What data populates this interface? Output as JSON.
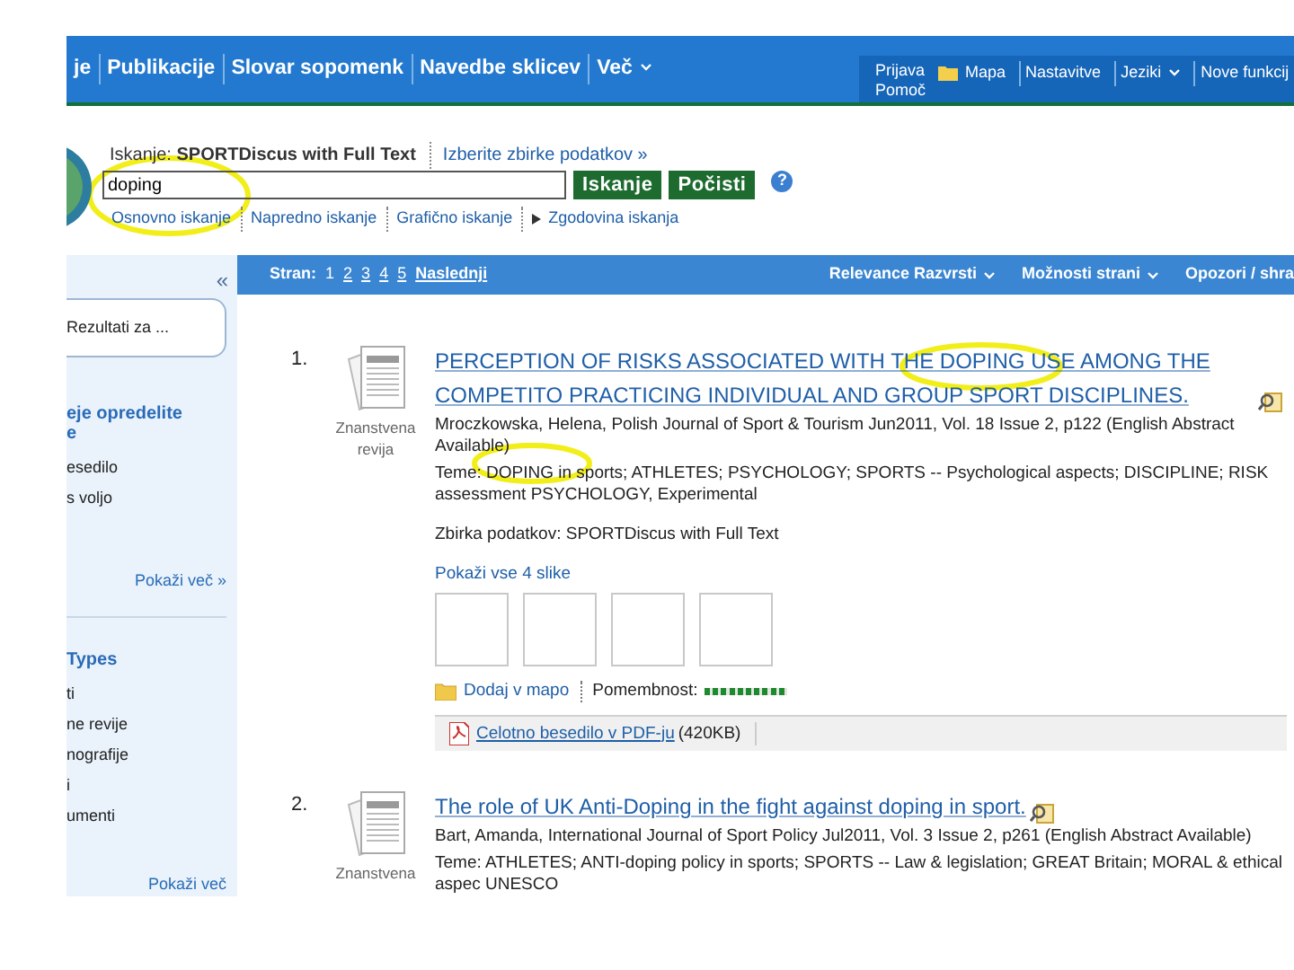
{
  "nav": {
    "items": [
      {
        "label": "je",
        "kind": "link"
      },
      {
        "label": "Publikacije",
        "kind": "link"
      },
      {
        "label": "Slovar sopomenk",
        "kind": "link"
      },
      {
        "label": "Navedbe sklicev",
        "kind": "link"
      },
      {
        "label": "Več",
        "kind": "dropdown"
      }
    ],
    "account": [
      "Prijava",
      "Pomoč"
    ],
    "tools": [
      {
        "label": "Mapa",
        "kind": "folder"
      },
      {
        "label": "Nastavitve",
        "kind": "link"
      },
      {
        "label": "Jeziki",
        "kind": "dropdown"
      },
      {
        "label": "Nove funkcij",
        "kind": "link"
      }
    ]
  },
  "search": {
    "label": "Iskanje: **SPORTDiscus with Full Text**",
    "databases_link": "Izberite zbirke podatkov »",
    "value": "doping",
    "buttons": [
      "Iskanje",
      "Počisti"
    ],
    "help": "?",
    "links": [
      {
        "label": "Osnovno iskanje",
        "kind": "link"
      },
      {
        "label": "Napredno iskanje",
        "kind": "link"
      },
      {
        "label": "Grafično iskanje",
        "kind": "link"
      },
      {
        "label": "Zgodovina iskanja",
        "kind": "expand"
      }
    ]
  },
  "sidebar": {
    "collapse": "«",
    "result_box": "Rezultati za ...",
    "sections": [
      {
        "heading_lines": [
          "eje opredelite",
          "e"
        ],
        "items": [
          "esedilo",
          "s voljo"
        ],
        "more": "Pokaži več »"
      },
      {
        "heading_lines": [
          "Types"
        ],
        "items": [
          "ti",
          "ne revije",
          "nografije",
          "i",
          "umenti"
        ],
        "more": "Pokaži več"
      }
    ]
  },
  "toolbar": {
    "pages_label": "Stran:",
    "pages": [
      {
        "label": "1",
        "selected": true
      },
      {
        "label": "2",
        "selected": false
      },
      {
        "label": "3",
        "selected": false
      },
      {
        "label": "4",
        "selected": false
      },
      {
        "label": "5",
        "selected": false
      }
    ],
    "next": "Naslednji",
    "menus": [
      {
        "label": "Relevance Razvrsti",
        "kind": "dropdown"
      },
      {
        "label": "Možnosti strani",
        "kind": "dropdown"
      },
      {
        "label": "Opozori / shra",
        "kind": "plain"
      }
    ]
  },
  "results": [
    {
      "number": "1.",
      "type": "Znanstvena revija",
      "title": "PERCEPTION OF RISKS ASSOCIATED WITH THE DOPING USE AMONG THE COMPETITO PRACTICING INDIVIDUAL AND GROUP SPORT DISCIPLINES.",
      "source": "Mroczkowska, Helena, Polish Journal of Sport & Tourism Jun2011, Vol. 18 Issue 2, p122 (English Abstract Available)",
      "subjects": "Teme: DOPING in sports; ATHLETES; PSYCHOLOGY; SPORTS -- Psychological aspects; DISCIPLINE; RISK assessment PSYCHOLOGY, Experimental",
      "database": "Zbirka podatkov: SPORTDiscus with Full Text",
      "images_link": "Pokaži vse 4 slike",
      "thumbnails": [
        {
          "kind": "empty"
        },
        {
          "kind": "empty"
        },
        {
          "kind": "empty"
        },
        {
          "kind": "empty"
        }
      ],
      "add_to_folder": "Dodaj v mapo",
      "relevance_label": "Pomembnost:",
      "level": 1,
      "pdf_link": "Celotno besedilo v PDF-ju",
      "pdf_size": "(420KB)"
    },
    {
      "number": "2.",
      "type": "Znanstvena",
      "title": "The role of UK Anti-Doping in the fight against doping in sport.",
      "source": "Bart, Amanda, International Journal of Sport Policy Jul2011, Vol. 3 Issue 2, p261 (English Abstract Available)",
      "subjects": "Teme: ATHLETES; ANTI-doping policy in sports; SPORTS -- Law & legislation; GREAT Britain; MORAL & ethical aspec UNESCO"
    }
  ],
  "highlights": [
    {
      "kind": "ellipse"
    },
    {
      "kind": "ellipse"
    },
    {
      "kind": "ellipse"
    }
  ]
}
